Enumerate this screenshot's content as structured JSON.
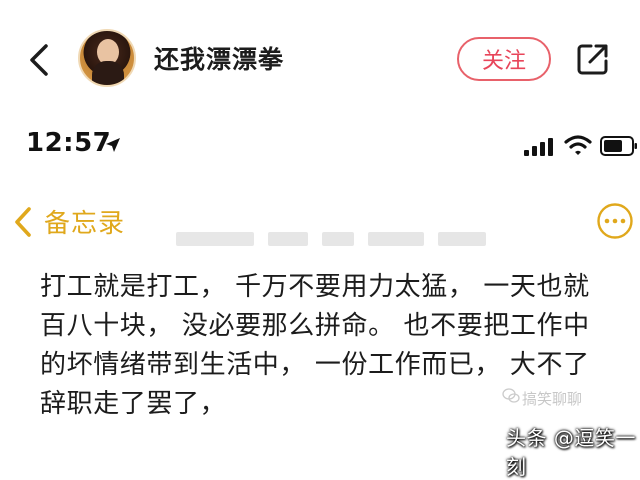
{
  "header": {
    "username": "还我漂漂拳",
    "follow_label": "关注"
  },
  "status_bar": {
    "time": "12:57"
  },
  "notes": {
    "title": "备忘录",
    "body_lines": [
      "打工就是打工， 千万不要用力太猛， 一天也就",
      "百八十块， 没必要那么拼命。 也不要把工作中",
      "的坏情绪带到生活中， 一份工作而已， 大不了",
      "辞职走了罢了，"
    ]
  },
  "watermarks": {
    "faded_account": "搞笑聊聊",
    "platform": "头条 @逗笑一刻"
  },
  "colors": {
    "follow_accent": "#e8455a",
    "notes_accent": "#e0a81c"
  },
  "icons": [
    "chevron-left-icon",
    "share-icon",
    "location-arrow-icon",
    "signal-icon",
    "wifi-icon",
    "battery-icon",
    "more-icon",
    "wechat-icon"
  ]
}
